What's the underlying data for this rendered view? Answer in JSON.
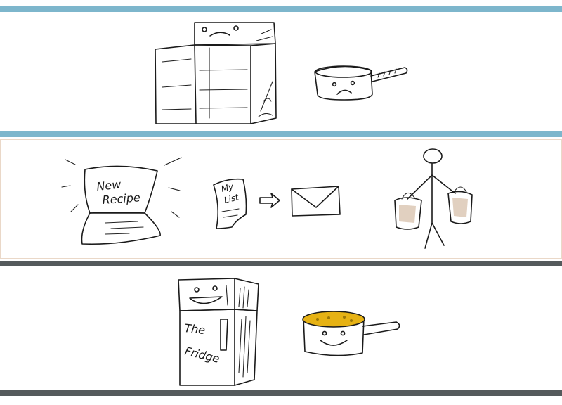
{
  "panels": [
    {
      "id": "empty-kitchen"
    },
    {
      "id": "shopping",
      "laptop_text_line1": "New",
      "laptop_text_line2": "Recipe",
      "list_text_line1": "My",
      "list_text_line2": "List"
    },
    {
      "id": "full-kitchen",
      "fridge_text_line1": "The",
      "fridge_text_line2": "Fridge"
    }
  ],
  "colors": {
    "blue_bar": "#7db6cc",
    "beige_frame": "#ead8c8",
    "dark_bar": "#555a5c",
    "soup": "#e6b214",
    "groceries": "#c9a98c"
  }
}
